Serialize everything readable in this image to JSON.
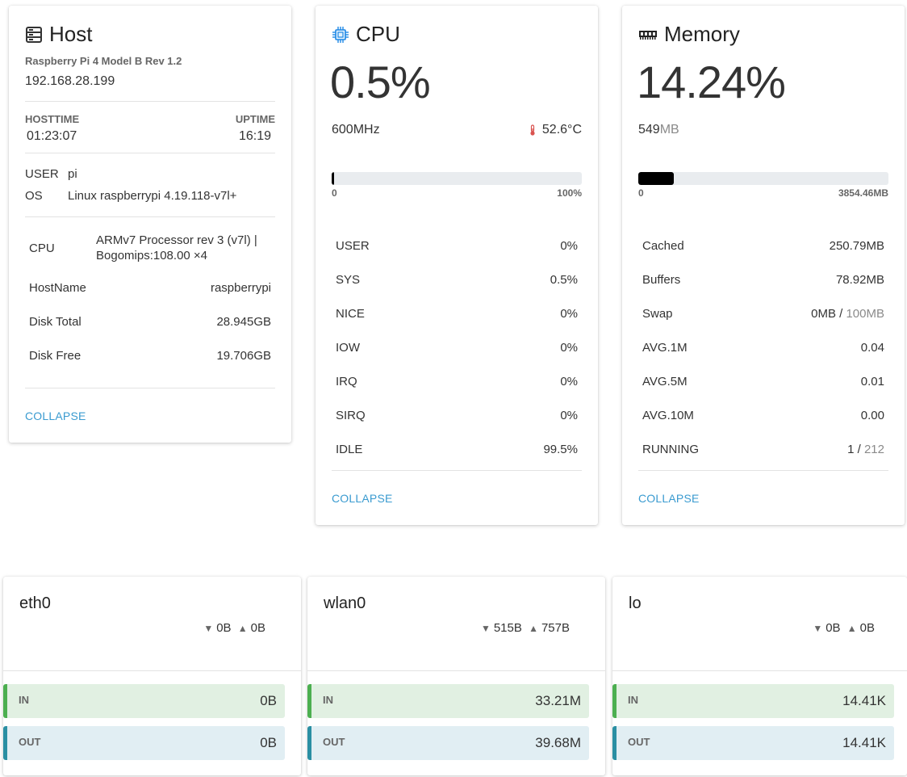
{
  "host": {
    "title": "Host",
    "model": "Raspberry Pi 4 Model B Rev 1.2",
    "ip": "192.168.28.199",
    "hosttime_label": "HOSTTIME",
    "hosttime": "01:23:07",
    "uptime_label": "UPTIME",
    "uptime": "16:19",
    "user_label": "USER",
    "user": "pi",
    "os_label": "OS",
    "os": "Linux raspberrypi 4.19.118-v7l+",
    "details": [
      {
        "label": "CPU",
        "value": "ARMv7 Processor rev 3 (v7l) | Bogomips:108.00 ×4"
      },
      {
        "label": "HostName",
        "value": "raspberrypi"
      },
      {
        "label": "Disk Total",
        "value": "28.945GB"
      },
      {
        "label": "Disk Free",
        "value": "19.706GB"
      }
    ],
    "collapse": "COLLAPSE"
  },
  "cpu": {
    "title": "CPU",
    "usage": "0.5%",
    "usage_fraction": 0.005,
    "freq": "600MHz",
    "temp": "52.6°C",
    "bar_min": "0",
    "bar_max": "100%",
    "stats": [
      {
        "label": "USER",
        "value": "0%"
      },
      {
        "label": "SYS",
        "value": "0.5%"
      },
      {
        "label": "NICE",
        "value": "0%"
      },
      {
        "label": "IOW",
        "value": "0%"
      },
      {
        "label": "IRQ",
        "value": "0%"
      },
      {
        "label": "SIRQ",
        "value": "0%"
      },
      {
        "label": "IDLE",
        "value": "99.5%"
      }
    ],
    "collapse": "COLLAPSE"
  },
  "memory": {
    "title": "Memory",
    "usage": "14.24%",
    "usage_fraction": 0.1424,
    "used_value": "549",
    "used_unit": "MB",
    "bar_min": "0",
    "bar_max": "3854.46MB",
    "stats": [
      {
        "label": "Cached",
        "value": "250.79MB"
      },
      {
        "label": "Buffers",
        "value": "78.92MB"
      },
      {
        "label": "Swap",
        "value": "0MB",
        "sep": " / ",
        "value2": "100MB"
      },
      {
        "label": "AVG.1M",
        "value": "0.04"
      },
      {
        "label": "AVG.5M",
        "value": "0.01"
      },
      {
        "label": "AVG.10M",
        "value": "0.00"
      },
      {
        "label": "RUNNING",
        "value": "1",
        "sep": " / ",
        "value2": "212"
      }
    ],
    "collapse": "COLLAPSE"
  },
  "network": [
    {
      "name": "eth0",
      "down": "0B",
      "up": "0B",
      "in_label": "IN",
      "in": "0B",
      "out_label": "OUT",
      "out": "0B"
    },
    {
      "name": "wlan0",
      "down": "515B",
      "up": "757B",
      "in_label": "IN",
      "in": "33.21M",
      "out_label": "OUT",
      "out": "39.68M"
    },
    {
      "name": "lo",
      "down": "0B",
      "up": "0B",
      "in_label": "IN",
      "in": "14.41K",
      "out_label": "OUT",
      "out": "14.41K"
    }
  ],
  "icons": {
    "host": "server-icon",
    "cpu": "chip-icon",
    "memory": "ram-icon",
    "temp": "thermometer-icon",
    "down": "triangle-down-icon",
    "up": "triangle-up-icon"
  },
  "colors": {
    "accent": "#3a9bd0",
    "in_border": "#4caf50",
    "in_bg": "#e1f0e2",
    "out_border": "#2a8fa3",
    "out_bg": "#e1eef3",
    "cpu_icon": "#1e88e5",
    "temp_icon": "#d9534f"
  }
}
